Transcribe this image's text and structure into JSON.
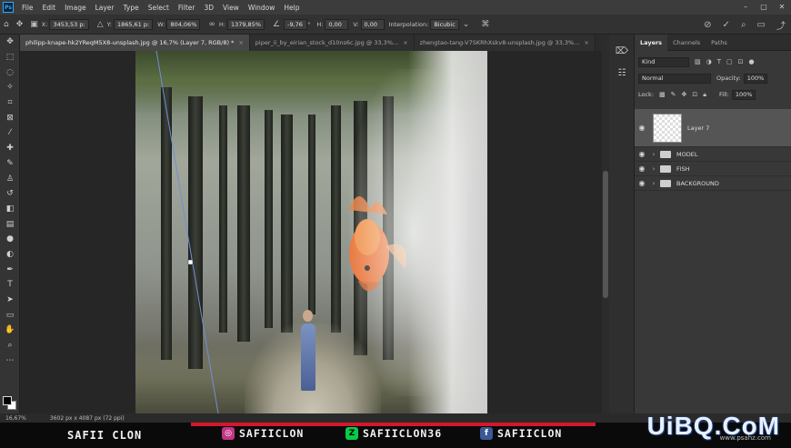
{
  "app": {
    "logo": "Ps"
  },
  "menu": [
    "File",
    "Edit",
    "Image",
    "Layer",
    "Type",
    "Select",
    "Filter",
    "3D",
    "View",
    "Window",
    "Help"
  ],
  "window_controls": [
    "–",
    "▢",
    "✕"
  ],
  "options": {
    "x_label": "X:",
    "x_value": "3453,53 p:",
    "y_label": "Y:",
    "y_value": "1865,61 p:",
    "w_label": "W:",
    "w_value": "804,06%",
    "h_label": "H:",
    "h_value": "1379,85%",
    "angle_value": "-9,76",
    "hskew_label": "H:",
    "hskew_value": "0,00",
    "vskew_label": "V:",
    "vskew_value": "0,00",
    "interp_label": "Interpolation:",
    "interp_value": "Bicubic"
  },
  "tabs": [
    {
      "label": "philipp-knape-hk2YReqM5X8-unsplash.jpg @ 16,7% (Layer 7, RGB/8) *",
      "close": "×"
    },
    {
      "label": "piper_ii_by_eirian_stock_d10ns6c.jpg @ 33,3%...",
      "close": "×"
    },
    {
      "label": "zhengtao-tang-V7SKRhXskv8-unsplash.jpg @ 33,3%...",
      "close": "×"
    }
  ],
  "panel": {
    "tabs": [
      "Layers",
      "Channels",
      "Paths"
    ],
    "kind_placeholder": "Kind",
    "blend_mode": "Normal",
    "opacity_label": "Opacity:",
    "opacity_value": "100%",
    "lock_label": "Lock:",
    "fill_label": "Fill:",
    "fill_value": "100%",
    "layers": [
      {
        "name": "Layer 7",
        "type": "layer",
        "selected": true
      },
      {
        "name": "MODEL",
        "type": "group"
      },
      {
        "name": "FISH",
        "type": "group"
      },
      {
        "name": "BACKGROUND",
        "type": "group"
      }
    ]
  },
  "status": {
    "zoom": "16,67%",
    "doc_info": "3602 px x 4087 px (72 ppi)"
  },
  "banner": {
    "name": "SAFII CLON",
    "instagram": "SAFIICLON",
    "deviantart": "SAFIICLON36",
    "facebook": "SAFIICLON",
    "watermark": "UiBQ.CoM",
    "watermark_sub": "www.psahz.com"
  },
  "colors": {
    "accent": "#31a8ff",
    "banner_red": "#d4172b",
    "instagram": "#c13584",
    "deviantart": "#05cc47",
    "facebook": "#3b5998"
  }
}
